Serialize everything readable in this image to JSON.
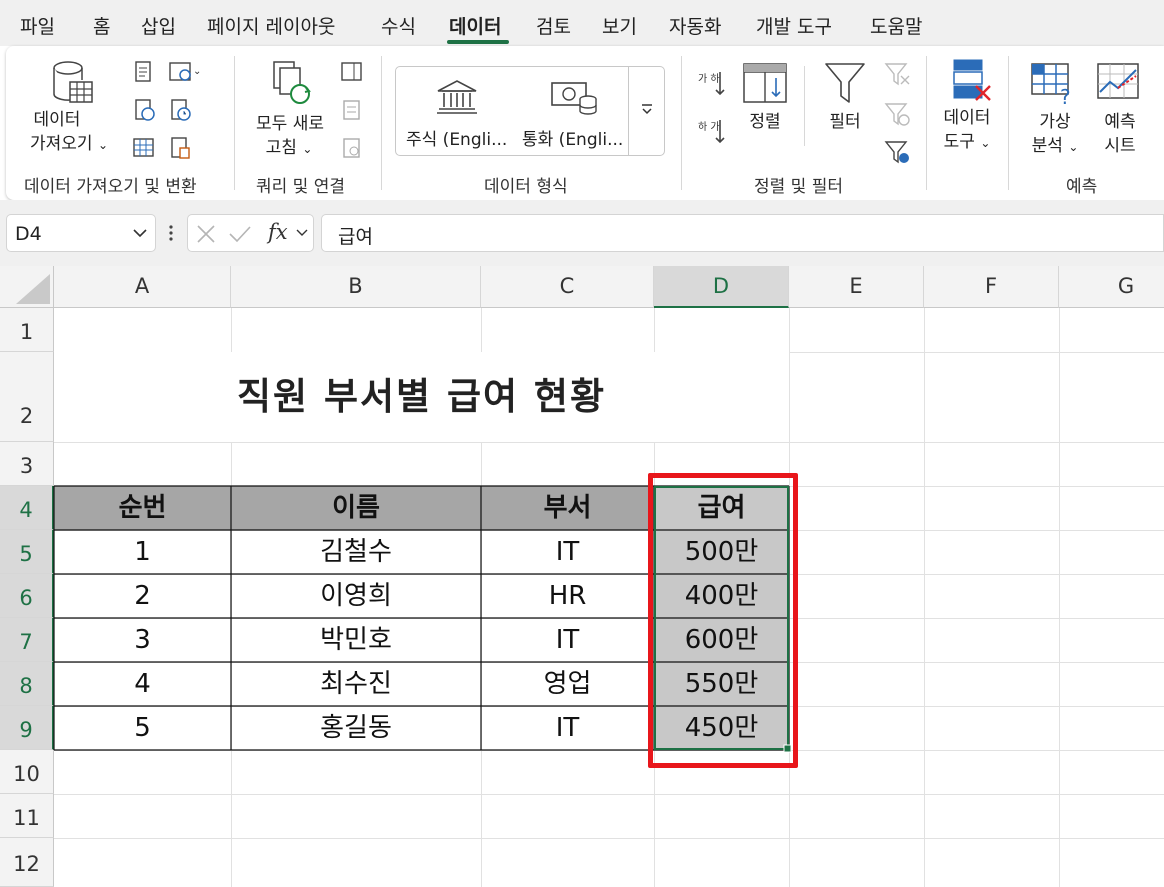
{
  "menu": {
    "tabs": [
      "파일",
      "홈",
      "삽입",
      "페이지 레이아웃",
      "수식",
      "데이터",
      "검토",
      "보기",
      "자동화",
      "개발 도구",
      "도움말"
    ],
    "active_tab": "데이터"
  },
  "ribbon": {
    "get_data_line1": "데이터",
    "get_data_line2": "가져오기",
    "group_get_transform": "데이터 가져오기 및 변환",
    "refresh_line1": "모두 새로",
    "refresh_line2": "고침",
    "group_queries": "쿼리 및 연결",
    "stocks": "주식 (Engli...",
    "currencies": "통화 (Engli...",
    "group_datatypes": "데이터 형식",
    "sort": "정렬",
    "filter": "필터",
    "group_sort_filter": "정렬 및 필터",
    "data_tools_line1": "데이터",
    "data_tools_line2": "도구",
    "whatif_line1": "가상",
    "whatif_line2": "분석",
    "forecast_line1": "예측",
    "forecast_line2": "시트",
    "group_forecast": "예측",
    "sort_az_glyph": "가 하",
    "sort_za_glyph": "하 가"
  },
  "formula_bar": {
    "name_box": "D4",
    "fx": "fx",
    "content": "급여"
  },
  "sheet": {
    "columns": [
      "A",
      "B",
      "C",
      "D",
      "E",
      "F",
      "G"
    ],
    "selected_column": "D",
    "rows": [
      "1",
      "2",
      "3",
      "4",
      "5",
      "6",
      "7",
      "8",
      "9",
      "10",
      "11",
      "12"
    ],
    "title": "직원 부서별 급여 현황",
    "table_headers": [
      "순번",
      "이름",
      "부서",
      "급여"
    ],
    "table_rows": [
      [
        "1",
        "김철수",
        "IT",
        "500만"
      ],
      [
        "2",
        "이영희",
        "HR",
        "400만"
      ],
      [
        "3",
        "박민호",
        "IT",
        "600만"
      ],
      [
        "4",
        "최수진",
        "영업",
        "550만"
      ],
      [
        "5",
        "홍길동",
        "IT",
        "450만"
      ]
    ]
  },
  "colors": {
    "accent": "#1e7145",
    "highlight_box": "#e8161b",
    "header_fill": "#a6a6a6",
    "selected_fill": "#c8c8c8"
  }
}
